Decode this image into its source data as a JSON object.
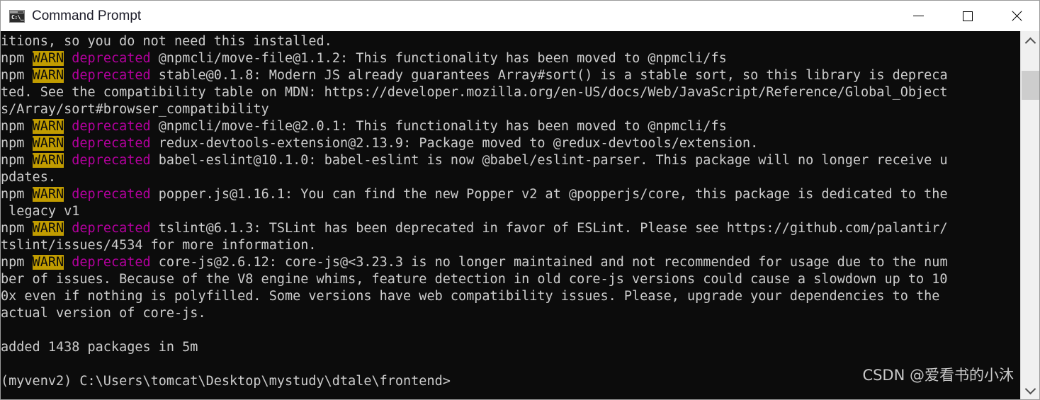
{
  "window": {
    "title": "Command Prompt",
    "icon": "cmd-icon",
    "prompt_glyph": "C:\\_",
    "controls": {
      "minimize_label": "—",
      "maximize_label": "□",
      "close_label": "✕"
    }
  },
  "colors": {
    "titlebar_bg": "#ffffff",
    "console_bg": "#0c0c0c",
    "console_fg": "#cccccc",
    "warn_bg": "#c19c00",
    "warn_fg": "#0c0c0c",
    "deprecated_fg": "#b4009e",
    "scrollbar_track": "#f0f0f0",
    "scrollbar_thumb": "#cdcdcd"
  },
  "console": {
    "lines": [
      [
        {
          "text": "itions, so you do not need this installed."
        }
      ],
      [
        {
          "text": "npm "
        },
        {
          "text": "WARN",
          "style": "warn"
        },
        {
          "text": " "
        },
        {
          "text": "deprecated",
          "style": "dep"
        },
        {
          "text": " @npmcli/move-file@1.1.2: This functionality has been moved to @npmcli/fs"
        }
      ],
      [
        {
          "text": "npm "
        },
        {
          "text": "WARN",
          "style": "warn"
        },
        {
          "text": " "
        },
        {
          "text": "deprecated",
          "style": "dep"
        },
        {
          "text": " stable@0.1.8: Modern JS already guarantees Array#sort() is a stable sort, so this library is depreca"
        }
      ],
      [
        {
          "text": "ted. See the compatibility table on MDN: https://developer.mozilla.org/en-US/docs/Web/JavaScript/Reference/Global_Object"
        }
      ],
      [
        {
          "text": "s/Array/sort#browser_compatibility"
        }
      ],
      [
        {
          "text": "npm "
        },
        {
          "text": "WARN",
          "style": "warn"
        },
        {
          "text": " "
        },
        {
          "text": "deprecated",
          "style": "dep"
        },
        {
          "text": " @npmcli/move-file@2.0.1: This functionality has been moved to @npmcli/fs"
        }
      ],
      [
        {
          "text": "npm "
        },
        {
          "text": "WARN",
          "style": "warn"
        },
        {
          "text": " "
        },
        {
          "text": "deprecated",
          "style": "dep"
        },
        {
          "text": " redux-devtools-extension@2.13.9: Package moved to @redux-devtools/extension."
        }
      ],
      [
        {
          "text": "npm "
        },
        {
          "text": "WARN",
          "style": "warn"
        },
        {
          "text": " "
        },
        {
          "text": "deprecated",
          "style": "dep"
        },
        {
          "text": " babel-eslint@10.1.0: babel-eslint is now @babel/eslint-parser. This package will no longer receive u"
        }
      ],
      [
        {
          "text": "pdates."
        }
      ],
      [
        {
          "text": "npm "
        },
        {
          "text": "WARN",
          "style": "warn"
        },
        {
          "text": " "
        },
        {
          "text": "deprecated",
          "style": "dep"
        },
        {
          "text": " popper.js@1.16.1: You can find the new Popper v2 at @popperjs/core, this package is dedicated to the"
        }
      ],
      [
        {
          "text": " legacy v1"
        }
      ],
      [
        {
          "text": "npm "
        },
        {
          "text": "WARN",
          "style": "warn"
        },
        {
          "text": " "
        },
        {
          "text": "deprecated",
          "style": "dep"
        },
        {
          "text": " tslint@6.1.3: TSLint has been deprecated in favor of ESLint. Please see https://github.com/palantir/"
        }
      ],
      [
        {
          "text": "tslint/issues/4534 for more information."
        }
      ],
      [
        {
          "text": "npm "
        },
        {
          "text": "WARN",
          "style": "warn"
        },
        {
          "text": " "
        },
        {
          "text": "deprecated",
          "style": "dep"
        },
        {
          "text": " core-js@2.6.12: core-js@<3.23.3 is no longer maintained and not recommended for usage due to the num"
        }
      ],
      [
        {
          "text": "ber of issues. Because of the V8 engine whims, feature detection in old core-js versions could cause a slowdown up to 10"
        }
      ],
      [
        {
          "text": "0x even if nothing is polyfilled. Some versions have web compatibility issues. Please, upgrade your dependencies to the"
        }
      ],
      [
        {
          "text": "actual version of core-js."
        }
      ],
      [
        {
          "text": ""
        }
      ],
      [
        {
          "text": "added 1438 packages in 5m"
        }
      ],
      [
        {
          "text": ""
        }
      ],
      [
        {
          "text": "(myvenv2) C:\\Users\\tomcat\\Desktop\\mystudy\\dtale\\frontend>"
        }
      ]
    ]
  },
  "scrollbar": {
    "up_arrow": "chevron-up",
    "down_arrow": "chevron-down",
    "thumb_position_percent": 11
  },
  "watermark": {
    "text": "CSDN @爱看书的小沐"
  }
}
